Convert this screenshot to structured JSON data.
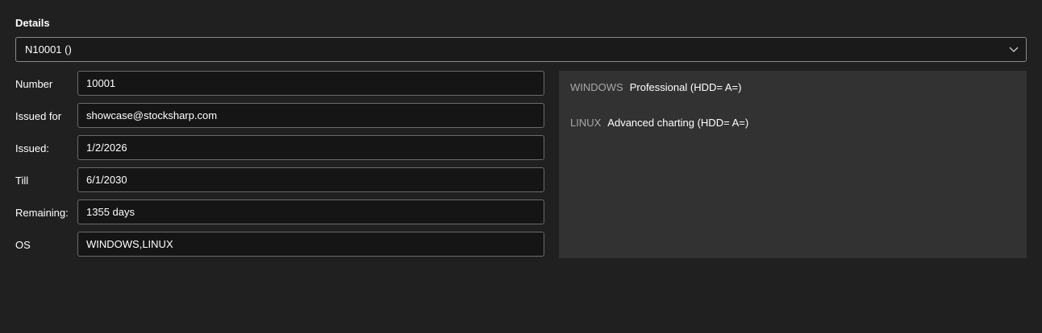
{
  "details": {
    "title": "Details",
    "selector_value": "N10001 ()"
  },
  "fields": [
    {
      "label": "Number",
      "value": "10001"
    },
    {
      "label": "Issued for",
      "value": "showcase@stocksharp.com"
    },
    {
      "label": "Issued:",
      "value": "1/2/2026"
    },
    {
      "label": "Till",
      "value": "6/1/2030"
    },
    {
      "label": "Remaining:",
      "value": "1355 days"
    },
    {
      "label": "OS",
      "value": "WINDOWS,LINUX"
    }
  ],
  "os_features": [
    {
      "os": "WINDOWS",
      "feature": "Professional (HDD= A=)"
    },
    {
      "os": "LINUX",
      "feature": "Advanced charting (HDD= A=)"
    }
  ],
  "colors": {
    "background": "#202020",
    "panel": "#323232",
    "input_background": "#151515"
  },
  "icons": {
    "selector_arrow": "chevron-down-icon"
  }
}
